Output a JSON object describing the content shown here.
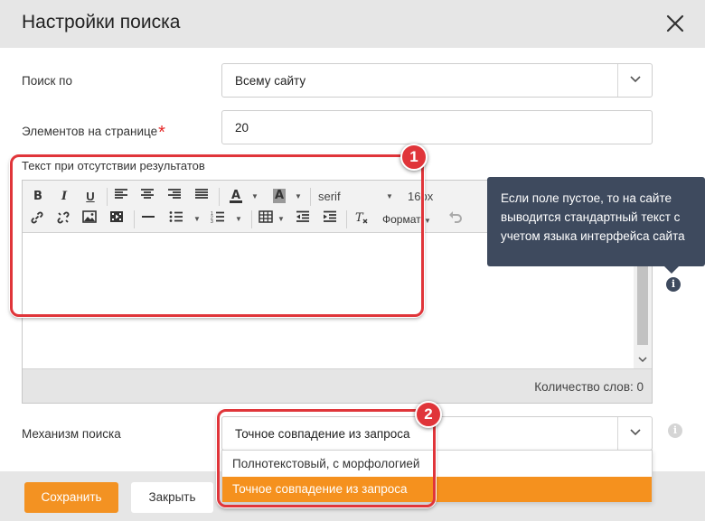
{
  "dialog": {
    "title": "Настройки поиска"
  },
  "search_by": {
    "label": "Поиск по",
    "value": "Всему сайту"
  },
  "per_page": {
    "label": "Элементов на странице",
    "required_mark": "*",
    "value": "20"
  },
  "no_results_text": {
    "label": "Текст при отсутствии результатов"
  },
  "editor": {
    "font_family": "serif",
    "font_size": "16px",
    "format_label": "Формат",
    "word_count": "Количество слов: 0"
  },
  "tooltip": {
    "text": "Если поле пустое, то на сайте выводится стандартный текст с учетом языка интерфейса сайта"
  },
  "engine": {
    "label": "Механизм поиска",
    "value": "Точное совпадение из запроса",
    "options": [
      "Полнотекстовый, с морфологией",
      "Точное совпадение из запроса"
    ]
  },
  "annotations": {
    "one": "1",
    "two": "2"
  },
  "footer": {
    "save": "Сохранить",
    "close": "Закрыть"
  },
  "colors": {
    "accent": "#f39222",
    "annotation": "#e0353a",
    "tooltip": "#3e4a5e"
  }
}
